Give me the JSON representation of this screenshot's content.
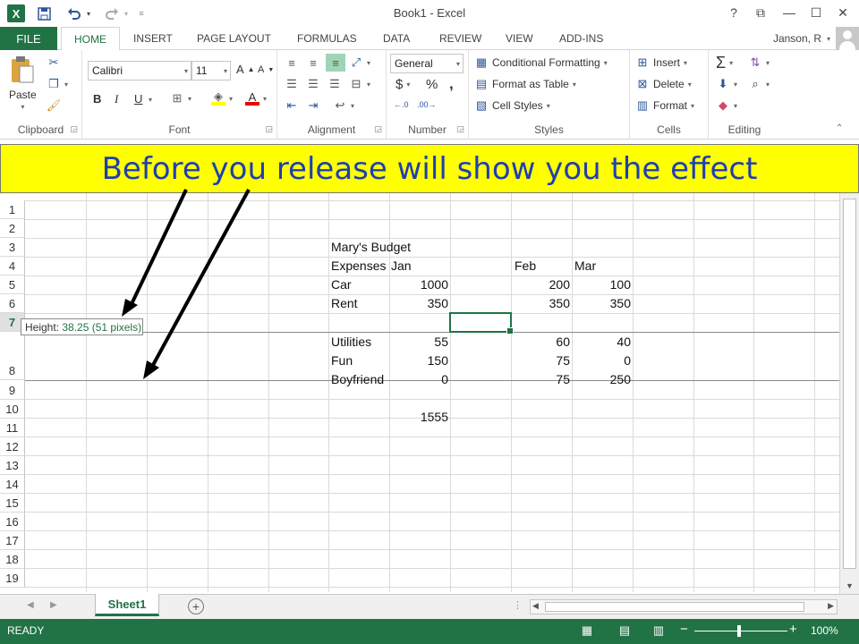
{
  "window": {
    "title": "Book1 - Excel",
    "logo": "X",
    "help": "?",
    "restore_ribbon": "⧉",
    "minimize": "—",
    "maximize": "☐",
    "close": "✕"
  },
  "quick_access": {
    "save_icon": "save-icon",
    "undo_icon": "undo-icon",
    "redo_icon": "redo-icon"
  },
  "tabs": {
    "file": "FILE",
    "items": [
      "HOME",
      "INSERT",
      "PAGE LAYOUT",
      "FORMULAS",
      "DATA",
      "REVIEW",
      "VIEW",
      "ADD-INS"
    ]
  },
  "user": {
    "name": "Janson, R"
  },
  "ribbon": {
    "clipboard": {
      "label": "Clipboard",
      "paste": "Paste"
    },
    "font": {
      "label": "Font",
      "name": "Calibri",
      "size": "11",
      "bold": "B",
      "italic": "I",
      "underline": "U",
      "grow": "A",
      "shrink": "A",
      "color": "A"
    },
    "alignment": {
      "label": "Alignment"
    },
    "number": {
      "label": "Number",
      "format": "General",
      "currency": "$",
      "percent": "%",
      "comma": ","
    },
    "styles": {
      "label": "Styles",
      "conditional": "Conditional Formatting",
      "table": "Format as Table",
      "cell": "Cell Styles"
    },
    "cells": {
      "label": "Cells",
      "insert": "Insert",
      "delete": "Delete",
      "format": "Format"
    },
    "editing": {
      "label": "Editing",
      "sum": "Σ"
    }
  },
  "banner": {
    "text": "Before you release will show you the effect",
    "background": "#ffff00",
    "text_color": "#1f3fb0"
  },
  "rows": [
    "1",
    "2",
    "3",
    "4",
    "5",
    "6",
    "7",
    "8",
    "9",
    "10",
    "11",
    "12",
    "13",
    "14",
    "15",
    "16",
    "17",
    "18",
    "19"
  ],
  "sheet": {
    "title": "Mary's Budget",
    "header": {
      "label": "Expenses",
      "jan": "Jan",
      "feb": "Feb",
      "mar": "Mar"
    },
    "items": [
      {
        "name": "Car",
        "jan": "1000",
        "feb": "200",
        "mar": "100"
      },
      {
        "name": "Rent",
        "jan": "350",
        "feb": "350",
        "mar": "350"
      },
      {
        "name": "Utilities",
        "jan": "55",
        "feb": "60",
        "mar": "40"
      },
      {
        "name": "Fun",
        "jan": "150",
        "feb": "75",
        "mar": "0"
      },
      {
        "name": "Boyfriend",
        "jan": "0",
        "feb": "75",
        "mar": "250"
      }
    ],
    "total": "1555"
  },
  "height_tooltip": {
    "label": "Height:",
    "value": "38.25 (51 pixels)"
  },
  "sheet_tabs": {
    "active": "Sheet1",
    "add": "+"
  },
  "status": {
    "text": "READY",
    "zoom": "100%"
  },
  "colors": {
    "excel_green": "#217346",
    "arrow": "#000000"
  }
}
